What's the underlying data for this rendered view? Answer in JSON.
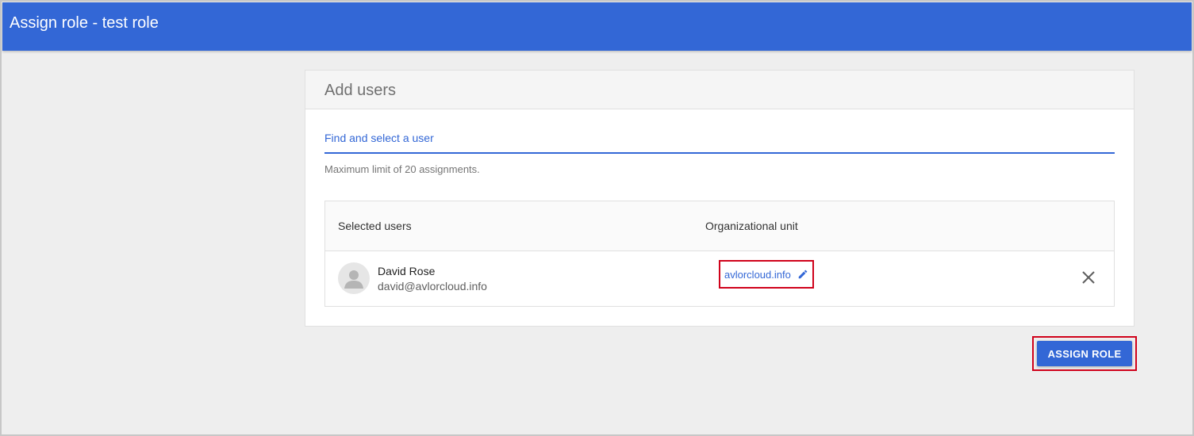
{
  "header": {
    "title": "Assign role - test role"
  },
  "card": {
    "title": "Add users",
    "search": {
      "placeholder": "Find and select a user",
      "value": ""
    },
    "limit_text": "Maximum limit of 20 assignments."
  },
  "table": {
    "columns": {
      "users": "Selected users",
      "org": "Organizational unit"
    },
    "rows": [
      {
        "name": "David Rose",
        "email": "david@avlorcloud.info",
        "org_unit": "avlorcloud.info"
      }
    ]
  },
  "actions": {
    "assign_label": "ASSIGN ROLE"
  },
  "icons": {
    "avatar": "user-avatar-icon",
    "edit": "pencil-icon",
    "remove": "close-icon"
  },
  "colors": {
    "primary": "#3367d6",
    "highlight": "#d0021b",
    "background": "#eeeeee"
  }
}
